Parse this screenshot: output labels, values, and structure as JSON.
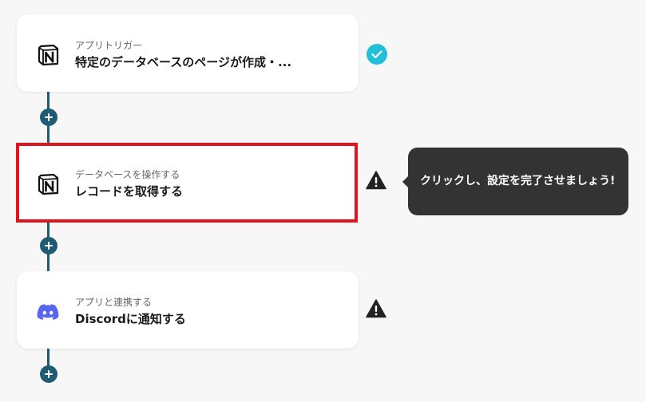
{
  "steps": [
    {
      "subtitle": "アプリトリガー",
      "title": "特定のデータベースのページが作成・...",
      "app_icon": "notion-icon",
      "status": "complete"
    },
    {
      "subtitle": "データベースを操作する",
      "title": "レコードを取得する",
      "app_icon": "notion-icon",
      "status": "warning",
      "selected": true
    },
    {
      "subtitle": "アプリと連携する",
      "title": "Discordに通知する",
      "app_icon": "discord-icon",
      "status": "warning"
    }
  ],
  "tooltip": {
    "text": "クリックし、設定を完了させましょう!"
  },
  "colors": {
    "background": "#f7f7f7",
    "connector": "#1f5c73",
    "check": "#21c0d8",
    "selected_border": "#e0141e",
    "discord": "#5865f2",
    "tooltip_bg": "#333333",
    "warning": "#222222"
  }
}
